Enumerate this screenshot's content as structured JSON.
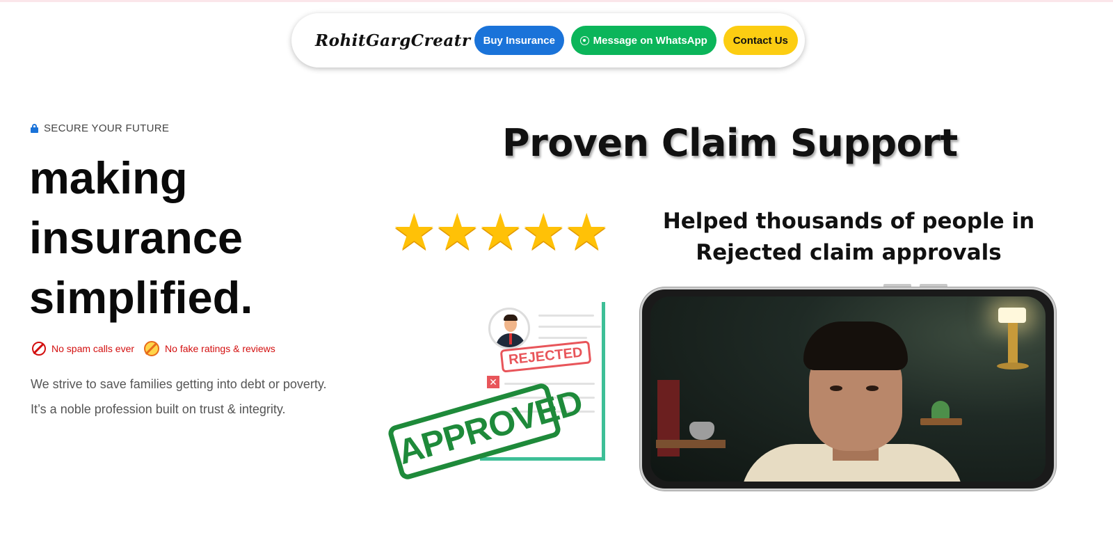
{
  "nav": {
    "logo": "RohitGargCreatr",
    "buy_label": "Buy Insurance",
    "whatsapp_label": "Message on WhatsApp",
    "contact_label": "Contact Us"
  },
  "hero": {
    "eyebrow": "SECURE YOUR FUTURE",
    "headline_lines": [
      "making",
      "insurance",
      "simplified."
    ],
    "badges": [
      "No spam calls ever",
      "No fake ratings & reviews"
    ],
    "description_lines": [
      "We strive to save families getting into debt or poverty.",
      "It’s a noble profession built on trust & integrity."
    ]
  },
  "claims": {
    "title": "Proven Claim Support",
    "rating_stars": 5,
    "helped_lines": [
      "Helped thousands of people in",
      "Rejected claim approvals"
    ],
    "stamp_rejected": "REJECTED",
    "stamp_approved": "APPROVED"
  },
  "colors": {
    "buy": "#1a73d9",
    "whatsapp": "#0bb55a",
    "contact": "#fccd12",
    "badge_red": "#d30f0f",
    "accent_green": "#3dbf97"
  }
}
